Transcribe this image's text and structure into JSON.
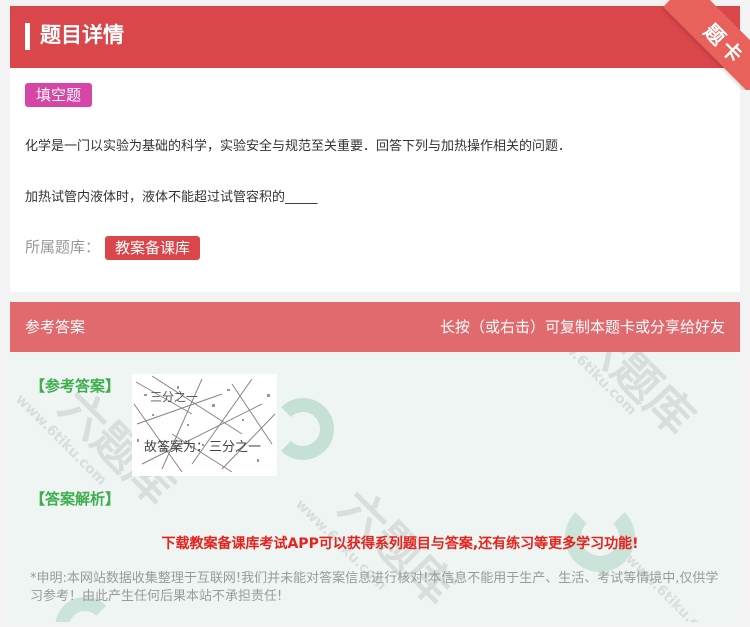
{
  "header": {
    "title": "题目详情"
  },
  "ribbon": {
    "label": "题卡"
  },
  "question": {
    "type_badge": "填空题",
    "text_line1": "化学是一门以实验为基础的科学，实验安全与规范至关重要．回答下列与加热操作相关的问题．",
    "text_line2": "加热试管内液体时，液体不能超过试管容积的_____",
    "bank_label": "所属题库：",
    "bank_tag": "教案备课库"
  },
  "answer_section": {
    "title": "参考答案",
    "hint": "长按（或右击）可复制本题卡或分享给好友",
    "answer_label": "【参考答案】",
    "answer_image_text_top": "三分之一",
    "answer_image_text_bottom": "故答案为：三分之一",
    "analysis_label": "【答案解析】",
    "promo": "下载教案备课库考试APP可以获得系列题目与答案,还有练习等更多学习功能!",
    "disclaimer": "*申明:本网站数据收集整理于互联网!我们并未能对答案信息进行核对!本信息不能用于生产、生活、考试等情境中,仅供学习参考！由此产生任何后果本站不承担责任!"
  },
  "watermark": {
    "text_cn": "六题库",
    "text_url": "www.6tiku.com"
  },
  "colors": {
    "header": "#d9474b",
    "answer_header": "#e06a6d",
    "badge": "#d646a6",
    "green": "#3fae4f",
    "promo": "#e5231e"
  }
}
